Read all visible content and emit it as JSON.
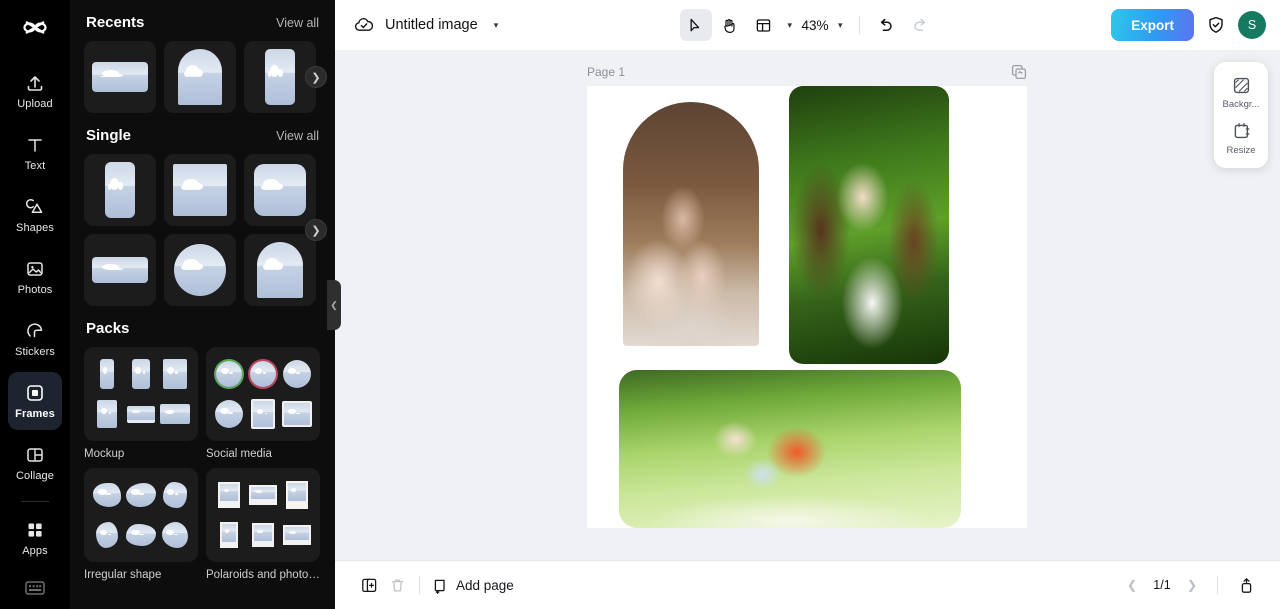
{
  "app": {
    "logo_icon": "capcut-logo-icon"
  },
  "rail": {
    "items": [
      {
        "label": "Upload",
        "icon": "upload-icon",
        "active": false
      },
      {
        "label": "Text",
        "icon": "text-icon",
        "active": false
      },
      {
        "label": "Shapes",
        "icon": "shapes-icon",
        "active": false
      },
      {
        "label": "Photos",
        "icon": "photos-icon",
        "active": false
      },
      {
        "label": "Stickers",
        "icon": "stickers-icon",
        "active": false
      },
      {
        "label": "Frames",
        "icon": "frames-icon",
        "active": true
      },
      {
        "label": "Collage",
        "icon": "collage-icon",
        "active": false
      },
      {
        "label": "Apps",
        "icon": "apps-icon",
        "active": false
      }
    ],
    "bottom_icon": "keyboard-shortcuts-icon"
  },
  "panel": {
    "sections": [
      {
        "title": "Recents",
        "link": "View all"
      },
      {
        "title": "Single",
        "link": "View all"
      },
      {
        "title": "Packs",
        "link": ""
      }
    ],
    "packs": [
      {
        "label": "Mockup"
      },
      {
        "label": "Social media"
      },
      {
        "label": "Irregular shape"
      },
      {
        "label": "Polaroids and photo f..."
      }
    ],
    "next_arrow_icon": "chevron-right-icon",
    "collapse_icon": "chevron-left-icon"
  },
  "topbar": {
    "cloud_icon": "cloud-saved-icon",
    "title": "Untitled image",
    "title_chevron_icon": "chevron-down-icon",
    "select_tool_icon": "cursor-select-icon",
    "hand_tool_icon": "hand-pan-icon",
    "layout_tool_icon": "layout-panels-icon",
    "layout_chevron_icon": "chevron-down-icon",
    "zoom_value": "43%",
    "zoom_chevron_icon": "chevron-down-icon",
    "undo_icon": "undo-icon",
    "redo_icon": "redo-icon",
    "export_label": "Export",
    "shield_icon": "shield-check-icon",
    "avatar_initial": "S",
    "accent_color": "#2f9bf0",
    "avatar_color": "#157a60"
  },
  "canvas": {
    "page_label": "Page 1",
    "duplicate_page_icon": "duplicate-page-icon",
    "photos": [
      {
        "name": "arch-family-photo"
      },
      {
        "name": "portrait-woman-photo"
      },
      {
        "name": "meadow-family-photo"
      }
    ]
  },
  "float_tools": [
    {
      "label": "Backgr...",
      "icon": "background-icon"
    },
    {
      "label": "Resize",
      "icon": "resize-icon"
    }
  ],
  "bottombar": {
    "duplicate_icon": "duplicate-icon",
    "delete_icon": "trash-icon",
    "add_page_icon": "add-page-icon",
    "add_page_label": "Add page",
    "prev_icon": "chevron-left-icon",
    "page_indicator": "1/1",
    "next_icon": "chevron-right-icon",
    "pages_panel_icon": "pages-panel-icon"
  }
}
